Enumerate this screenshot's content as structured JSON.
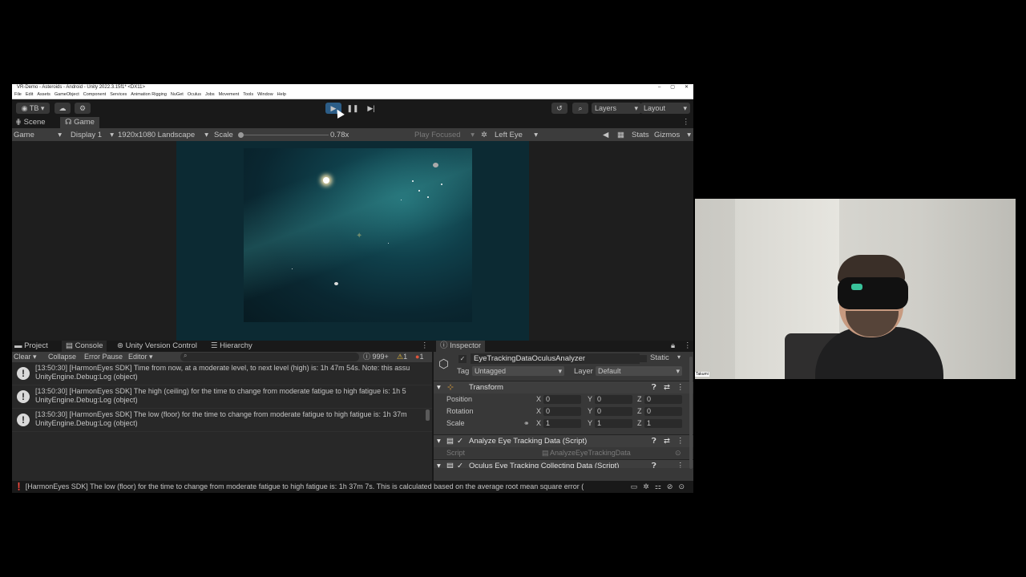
{
  "window": {
    "title": "VR-Demo - Asteroids - Android - Unity 2022.3.15f1* <DX11>",
    "controls": [
      "–",
      "▢",
      "✕"
    ]
  },
  "menu": [
    "File",
    "Edit",
    "Assets",
    "GameObject",
    "Component",
    "Services",
    "Animation Rigging",
    "NuGet",
    "Oculus",
    "Jobs",
    "Movement",
    "Tools",
    "Window",
    "Help"
  ],
  "toolbar": {
    "account": "TB",
    "layers": "Layers",
    "layout": "Layout"
  },
  "view_tabs": {
    "scene": "Scene",
    "game": "Game"
  },
  "gamebar": {
    "mode": "Game",
    "display": "Display 1",
    "resolution": "1920x1080 Landscape",
    "scale_label": "Scale",
    "scale_value": "0.78x",
    "play_focused": "Play Focused",
    "eye": "Left Eye",
    "stats": "Stats",
    "gizmos": "Gizmos"
  },
  "bottom_tabs": {
    "project": "Project",
    "console": "Console",
    "uvc": "Unity Version Control",
    "hierarchy": "Hierarchy"
  },
  "console": {
    "clear": "Clear",
    "collapse": "Collapse",
    "error_pause": "Error Pause",
    "editor": "Editor",
    "count_log": "999+",
    "count_warn": "1",
    "count_err": "1",
    "logs": [
      {
        "line1": "[13:50:30] [HarmonEyes SDK] Time from now, at a moderate level, to next level (high) is: 1h 47m 54s. Note: this assu",
        "line2": "UnityEngine.Debug:Log (object)"
      },
      {
        "line1": "[13:50:30] [HarmonEyes SDK] The high (ceiling) for the time to change from moderate fatigue to high fatigue is: 1h 5",
        "line2": "UnityEngine.Debug:Log (object)"
      },
      {
        "line1": "[13:50:30] [HarmonEyes SDK] The low (floor) for the time to change from moderate fatigue to high fatigue is: 1h 37m",
        "line2": "UnityEngine.Debug:Log (object)"
      }
    ]
  },
  "inspector": {
    "tab": "Inspector",
    "object_name": "EyeTrackingDataOculusAnalyzer",
    "static_label": "Static",
    "tag_label": "Tag",
    "tag_value": "Untagged",
    "layer_label": "Layer",
    "layer_value": "Default",
    "transform": "Transform",
    "position": {
      "label": "Position",
      "x": "0",
      "y": "0",
      "z": "0"
    },
    "rotation": {
      "label": "Rotation",
      "x": "0",
      "y": "0",
      "z": "0"
    },
    "scale": {
      "label": "Scale",
      "x": "1",
      "y": "1",
      "z": "1"
    },
    "axis_x": "X",
    "axis_y": "Y",
    "axis_z": "Z",
    "component1": "Analyze Eye Tracking Data (Script)",
    "script_label": "Script",
    "script_value": "AnalyzeEyeTrackingData",
    "component2": "Oculus Eye Tracking Collecting Data (Script)"
  },
  "statusbar": {
    "message": "[HarmonEyes SDK] The low (floor) for the time to change from moderate fatigue to high fatigue is: 1h 37m 7s. This is calculated based on the average root mean square error ("
  },
  "webcam": {
    "name_tag": "Takumi"
  },
  "colors": {
    "accent_play": "#2c5d87",
    "editor_bg": "#282828",
    "panel_bg": "#383838"
  }
}
